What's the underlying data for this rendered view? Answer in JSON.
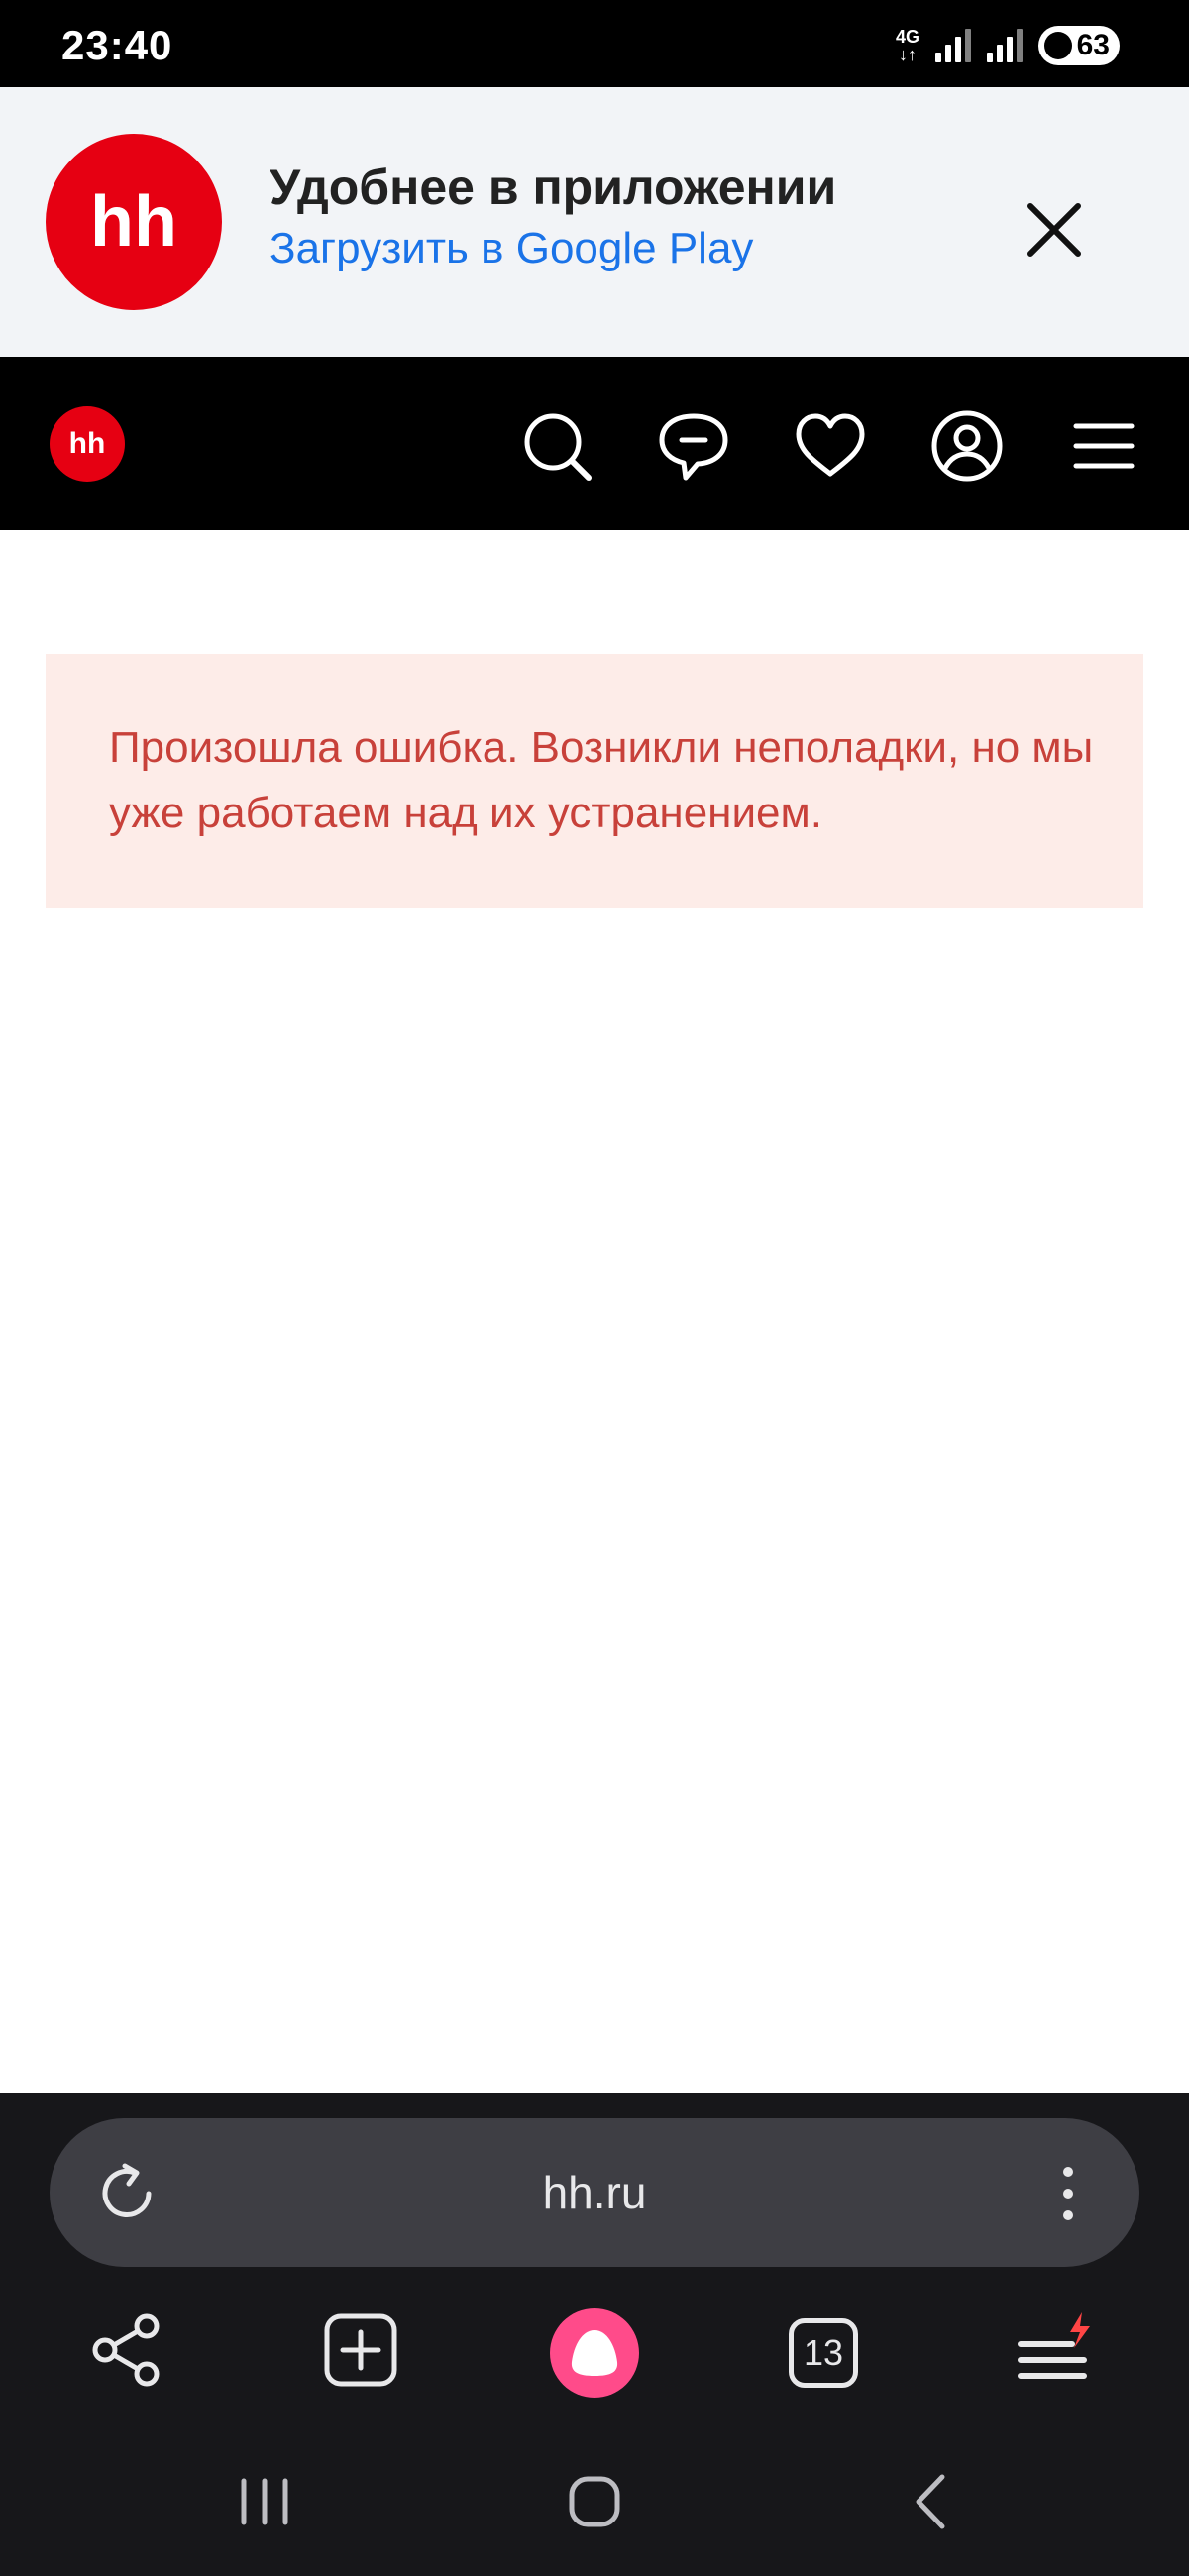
{
  "status_bar": {
    "time": "23:40",
    "network": "4G",
    "battery": "63"
  },
  "app_banner": {
    "logo": "hh",
    "title": "Удобнее в приложении",
    "link": "Загрузить в Google Play",
    "close_icon": "close-icon"
  },
  "site_header": {
    "logo": "hh",
    "icons": [
      "search-icon",
      "chat-icon",
      "heart-icon",
      "profile-icon",
      "menu-icon"
    ]
  },
  "error": {
    "message": "Произошла ошибка. Возникли неполадки, но мы уже работаем над их устранением."
  },
  "browser": {
    "url": "hh.ru",
    "tabs_count": "13",
    "toolbar_icons": [
      "share-icon",
      "new-tab-icon",
      "alice-icon",
      "tabs-icon",
      "menu-icon"
    ]
  },
  "colors": {
    "brand_red": "#e60012",
    "error_text": "#c8413a",
    "error_bg": "#fdece8",
    "link_blue": "#1a73e8",
    "alice_pink": "#ff4b8a"
  }
}
